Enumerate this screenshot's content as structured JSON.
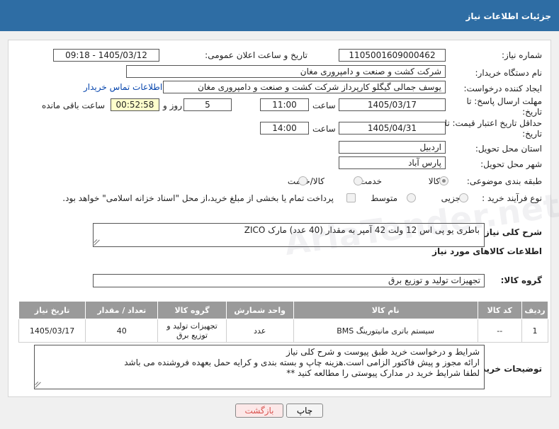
{
  "header": {
    "title": "جزئیات اطلاعات نیاز"
  },
  "fields": {
    "need_number_label": "شماره نیاز:",
    "need_number": "1105001609000462",
    "announce_label": "تاریخ و ساعت اعلان عمومی:",
    "announce_value": "1405/03/12 - 09:18",
    "buyer_org_label": "نام دستگاه خریدار:",
    "buyer_org": "شرکت کشت و صنعت و دامپروری مغان",
    "requester_label": "ایجاد کننده درخواست:",
    "requester": "یوسف جمالی گیگلو کارپرداز شرکت کشت و صنعت و دامپروری مغان",
    "contact_link": "اطلاعات تماس خریدار",
    "deadline_label": "مهلت ارسال پاسخ: تا تاریخ:",
    "deadline_date": "1405/03/17",
    "time_label": "ساعت",
    "deadline_time": "11:00",
    "days_value": "5",
    "days_label": "روز و",
    "remaining_value": "00:52:58",
    "remaining_label": "ساعت باقی مانده",
    "validity_label": "حداقل تاریخ اعتبار قیمت: تا تاریخ:",
    "validity_date": "1405/04/31",
    "validity_time": "14:00",
    "province_label": "استان محل تحویل:",
    "province": "اردبیل",
    "city_label": "شهر محل تحویل:",
    "city": "پارس آباد",
    "category_label": "طبقه بندی موضوعی:",
    "category_options": [
      "کالا",
      "خدمت",
      "کالا/خدمت"
    ],
    "process_label": "نوع فرآیند خرید :",
    "process_options": [
      "جزیی",
      "متوسط"
    ],
    "payment_note": "پرداخت تمام یا بخشی از مبلغ خرید،از محل \"اسناد خزانه اسلامی\" خواهد بود."
  },
  "summary": {
    "label": "شرح کلی نیاز:",
    "text": "باطری یو پی اس 12 ولت 42 آمپر به مقدار (40 عدد) مارک  ZICO"
  },
  "goods_section_title": "اطلاعات کالاهای مورد نیاز",
  "goods_group": {
    "label": "گروه کالا:",
    "value": "تجهیزات تولید و توزیع برق"
  },
  "table": {
    "headers": [
      "ردیف",
      "کد کالا",
      "نام کالا",
      "واحد شمارش",
      "گروه کالا",
      "تعداد / مقدار",
      "تاریخ نیاز"
    ],
    "rows": [
      [
        "1",
        "--",
        "سیستم باتری مانیتورینگ BMS",
        "عدد",
        "تجهیزات تولید و توزیع برق",
        "40",
        "1405/03/17"
      ]
    ]
  },
  "buyer_notes": {
    "label": "توضیحات خریدار:",
    "lines": [
      "شرایط و درخواست خرید طبق پیوست و شرح کلی نیاز",
      "ارائه مجوز و پیش فاکتور الزامی است.هزینه چاپ و بسته بندی و کرایه حمل بعهده فروشنده می باشد",
      "لطفا شرایط خرید در مدارک پیوستی را مطالعه کنید **"
    ]
  },
  "buttons": {
    "print": "چاپ",
    "back": "بازگشت"
  },
  "colors": {
    "header_bg": "#2e6da4",
    "link": "#0645ad",
    "table_header": "#9a9a9a",
    "remaining_bg": "#ffffcc"
  }
}
